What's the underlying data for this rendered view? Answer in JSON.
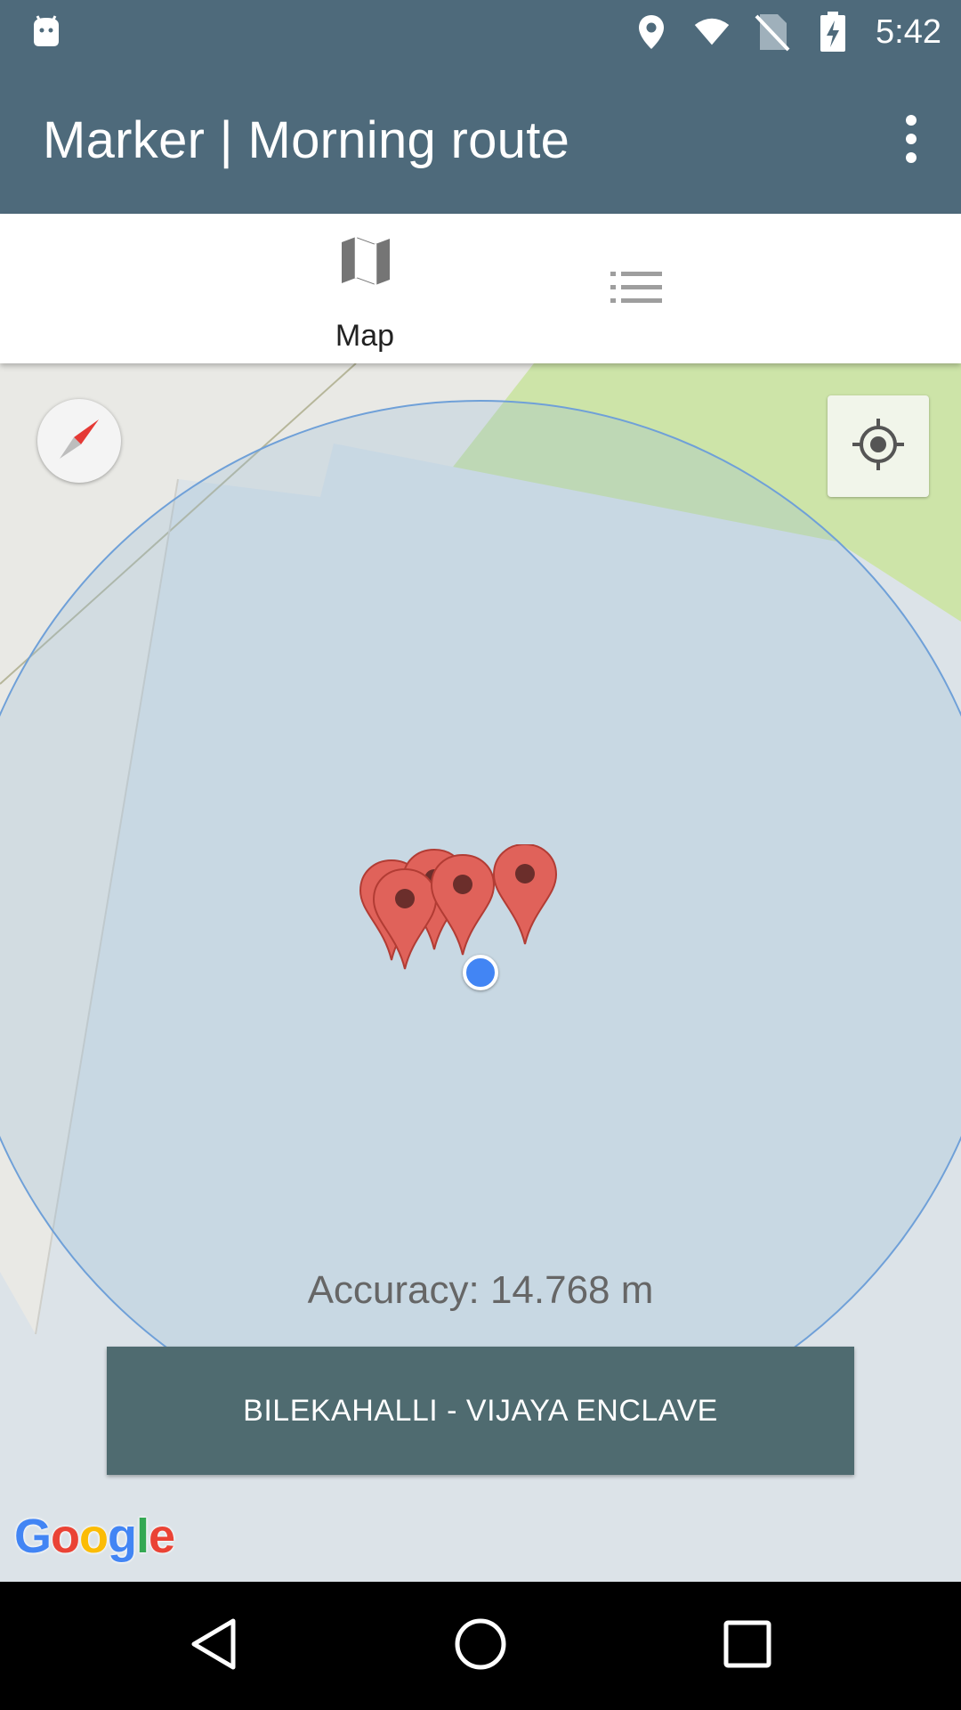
{
  "status_bar": {
    "time": "5:42",
    "icons": [
      "android-icon",
      "location-icon",
      "wifi-icon",
      "no-sim-icon",
      "battery-charging-icon"
    ]
  },
  "app_bar": {
    "title": "Marker | Morning route",
    "overflow_icon": "more-vert-icon"
  },
  "tabs": [
    {
      "label": "Map",
      "icon": "map-icon",
      "selected": true
    },
    {
      "label": "",
      "icon": "list-icon",
      "selected": false
    }
  ],
  "map": {
    "compass_icon": "compass-icon",
    "locate_icon": "my-location-icon",
    "accuracy_text": "Accuracy: 14.768 m",
    "place_button_label": "BILEKAHALLI - VIJAYA ENCLAVE",
    "logo": "Google",
    "marker_count": 5,
    "colors": {
      "marker": "#e0625a",
      "my_location": "#4285f4",
      "accuracy_circle": "#6fa0d8",
      "park": "#cde4a8"
    }
  },
  "nav_bar": {
    "buttons": [
      "back-icon",
      "home-icon",
      "recents-icon"
    ]
  }
}
